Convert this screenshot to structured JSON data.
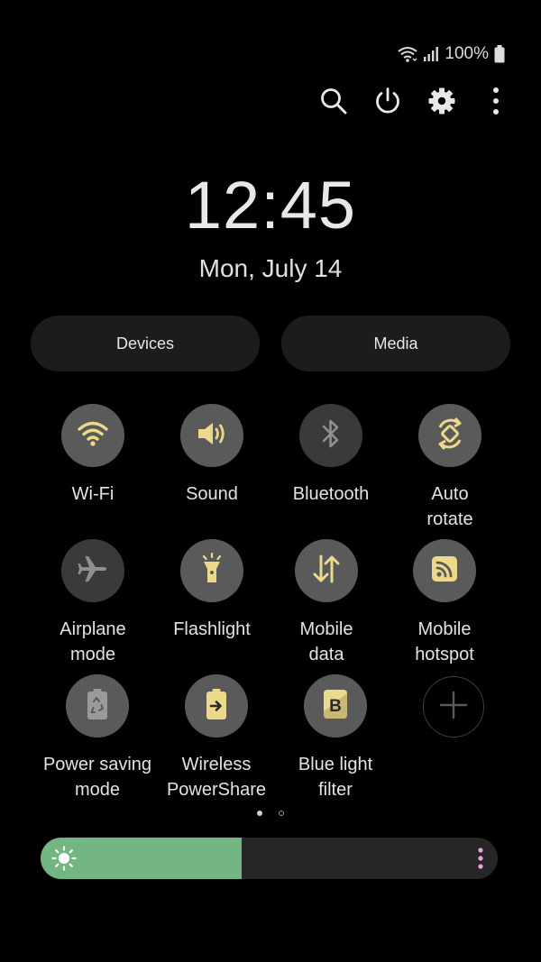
{
  "status_bar": {
    "battery_text": "100%",
    "icons": [
      "wifi-icon",
      "signal-icon",
      "battery-icon"
    ]
  },
  "top_actions": {
    "icons": [
      "search-icon",
      "power-icon",
      "gear-icon",
      "more-vertical-icon"
    ]
  },
  "clock": {
    "time": "12:45",
    "date": "Mon, July 14"
  },
  "panels": {
    "devices_label": "Devices",
    "media_label": "Media"
  },
  "tiles": [
    {
      "name": "wifi",
      "line1": "Wi-Fi",
      "line2": "",
      "state": "on",
      "icon": "wifi-icon"
    },
    {
      "name": "sound",
      "line1": "Sound",
      "line2": "",
      "state": "on",
      "icon": "speaker-icon"
    },
    {
      "name": "bluetooth",
      "line1": "Bluetooth",
      "line2": "",
      "state": "off",
      "icon": "bluetooth-icon"
    },
    {
      "name": "auto-rotate",
      "line1": "Auto",
      "line2": "rotate",
      "state": "on",
      "icon": "rotate-icon"
    },
    {
      "name": "airplane-mode",
      "line1": "Airplane",
      "line2": "mode",
      "state": "off",
      "icon": "airplane-icon"
    },
    {
      "name": "flashlight",
      "line1": "Flashlight",
      "line2": "",
      "state": "on",
      "icon": "flashlight-icon"
    },
    {
      "name": "mobile-data",
      "line1": "Mobile",
      "line2": "data",
      "state": "on",
      "icon": "data-arrows-icon"
    },
    {
      "name": "mobile-hotspot",
      "line1": "Mobile",
      "line2": "hotspot",
      "state": "on",
      "icon": "hotspot-icon"
    },
    {
      "name": "power-saving-mode",
      "line1": "Power saving",
      "line2": "mode",
      "state": "on",
      "icon": "battery-recycle-icon"
    },
    {
      "name": "wireless-powershare",
      "line1": "Wireless",
      "line2": "PowerShare",
      "state": "on",
      "icon": "battery-share-icon"
    },
    {
      "name": "blue-light-filter",
      "line1": "Blue light",
      "line2": "filter",
      "state": "on",
      "icon": "blue-light-icon"
    },
    {
      "name": "add-tile",
      "line1": "",
      "line2": "",
      "state": "add",
      "icon": "plus-icon"
    }
  ],
  "pager": {
    "pages": 2,
    "current": 1
  },
  "brightness": {
    "level_fraction": 0.44,
    "icon": "sun-icon"
  },
  "colors": {
    "background": "#000000",
    "tile_on": "#5a5a5a",
    "tile_off": "#3a3a3a",
    "icon_accent": "#ecd98a",
    "icon_inactive": "#8f8f8f",
    "brightness_fill": "#73b683",
    "more_dots": "#e6a5e6"
  }
}
